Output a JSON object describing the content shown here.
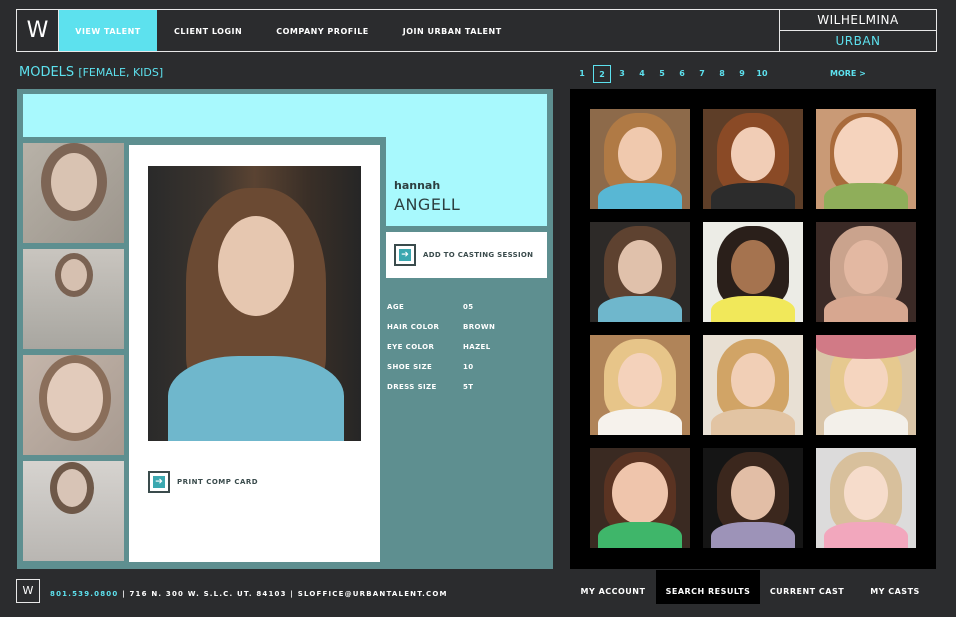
{
  "header": {
    "logo": "W",
    "nav": [
      "view talent",
      "client login",
      "company profile",
      "join urban talent"
    ],
    "active_nav": 0,
    "brand_top": "WILHELMINA",
    "brand_bottom": "URBAN"
  },
  "section": {
    "title": "MODELS",
    "subtitle": "[FEMALE, KIDS]"
  },
  "pagination": {
    "pages": [
      "1",
      "2",
      "3",
      "4",
      "5",
      "6",
      "7",
      "8",
      "9",
      "10"
    ],
    "current": "2",
    "more": "MORE >"
  },
  "profile": {
    "first_name": "hannah",
    "last_name": "ANGELL",
    "add_to_casting": "ADD TO CASTING SESSION",
    "print_comp_card": "PRINT COMP CARD",
    "stats": [
      {
        "label": "AGE",
        "value": "05"
      },
      {
        "label": "HAIR COLOR",
        "value": "BROWN"
      },
      {
        "label": "EYE COLOR",
        "value": "HAZEL"
      },
      {
        "label": "SHOE SIZE",
        "value": "10"
      },
      {
        "label": "DRESS SIZE",
        "value": "5T"
      }
    ]
  },
  "colors": {
    "accent": "#5de1ee",
    "panel": "#5e8f90",
    "light_band": "#a8f9fd",
    "background": "#2b2c2e"
  },
  "footer": {
    "logo": "W",
    "phone": "801.539.0800",
    "address": " | 716 N. 300 W. S.L.C. UT. 84103 | ",
    "email": "SLOFFICE@URBANTALENT.COM"
  },
  "bottom_tabs": [
    "MY ACCOUNT",
    "SEARCH RESULTS",
    "CURRENT CAST",
    "MY CASTS"
  ],
  "active_bottom_tab": 1
}
